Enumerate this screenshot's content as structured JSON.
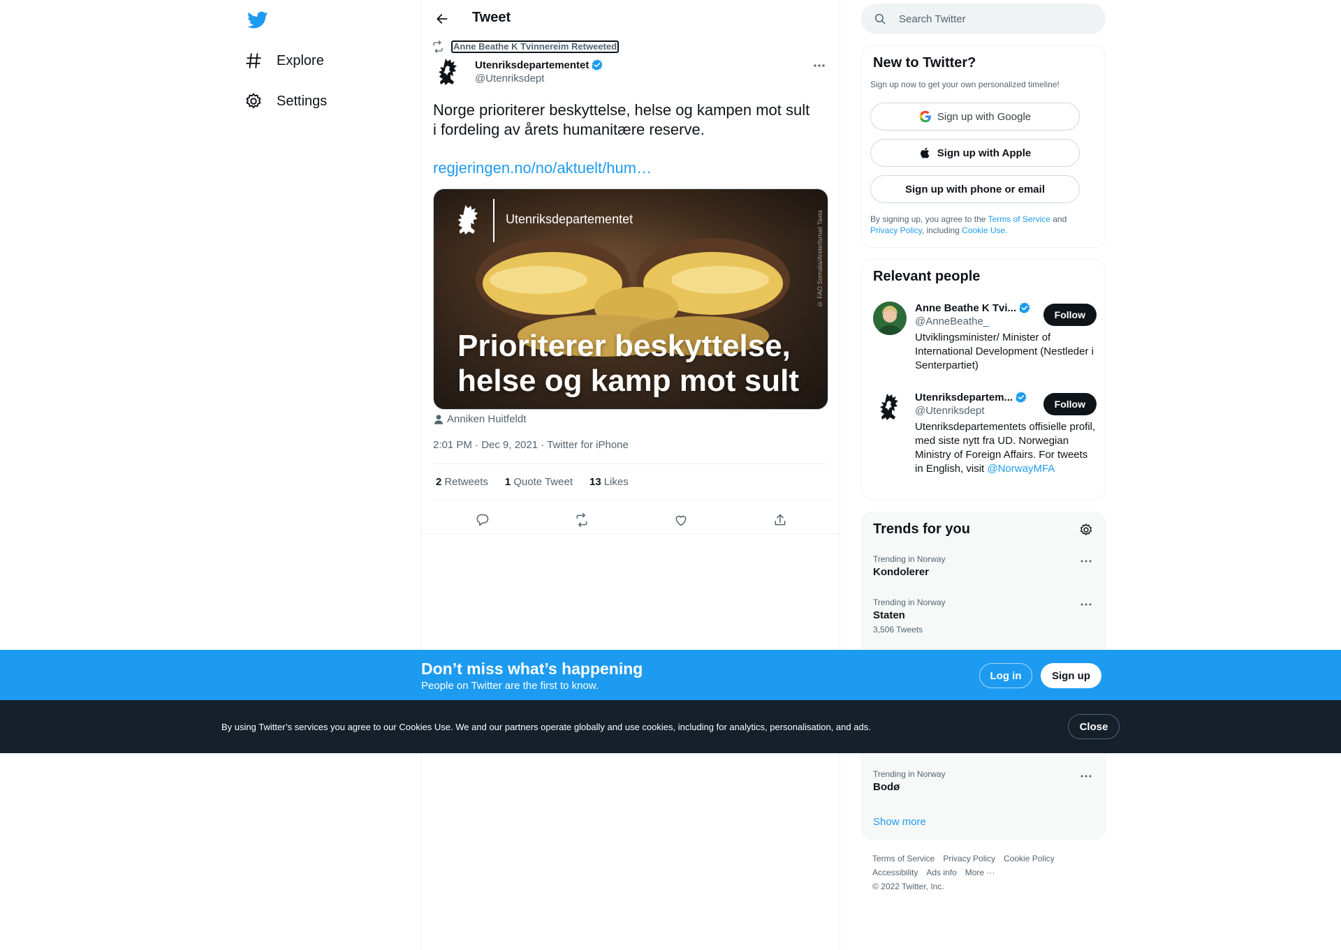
{
  "nav": {
    "items": [
      {
        "label": "Explore",
        "icon": "hashtag-icon"
      },
      {
        "label": "Settings",
        "icon": "gear-icon"
      }
    ]
  },
  "header": {
    "title": "Tweet"
  },
  "tweet": {
    "retweeted_by": "Anne Beathe K Tvinnereim Retweeted",
    "author_name": "Utenriksdepartementet",
    "author_handle": "@Utenriksdept",
    "text": "Norge prioriterer beskyttelse, helse og kampen mot sult\ni fordeling av årets humanitære reserve.",
    "link": "regjeringen.no/no/aktuelt/hum…",
    "media": {
      "brand": "Utenriksdepartementet",
      "headline": "Prioriterer beskyttelse,\nhelse og kamp mot sult",
      "credit": "© FAO Somalia/Arete/Ismail Taxta"
    },
    "tagged_person": "Anniken Huitfeldt",
    "timestamp": "2:01 PM · Dec 9, 2021 · Twitter for iPhone",
    "stats": {
      "retweets_count": "2",
      "retweets_label": "Retweets",
      "quotes_count": "1",
      "quotes_label": "Quote Tweet",
      "likes_count": "13",
      "likes_label": "Likes"
    }
  },
  "search": {
    "placeholder": "Search Twitter"
  },
  "new_to_twitter": {
    "title": "New to Twitter?",
    "subtitle": "Sign up now to get your own personalized timeline!",
    "google_label": "Sign up with Google",
    "apple_label": "Sign up with Apple",
    "phone_label": "Sign up with phone or email",
    "terms_prefix": "By signing up, you agree to the ",
    "terms_link": "Terms of Service",
    "terms_and": " and ",
    "privacy_link": "Privacy Policy",
    "terms_including": ", including ",
    "cookie_link": "Cookie Use."
  },
  "relevant_people": {
    "title": "Relevant people",
    "people": [
      {
        "name": "Anne Beathe K Tvi...",
        "handle": "@AnneBeathe_",
        "bio": "Utviklingsminister/ Minister of International Development (Nestleder i Senterpartiet)",
        "follow_label": "Follow"
      },
      {
        "name": "Utenriksdepartem...",
        "handle": "@Utenriksdept",
        "bio": "Utenriksdepartementets offisielle profil, med siste nytt fra UD. Norwegian Ministry of Foreign Affairs. For tweets in English, visit ",
        "bio_link": "@NorwayMFA",
        "follow_label": "Follow"
      }
    ]
  },
  "trends": {
    "title": "Trends for you",
    "items": [
      {
        "context": "Trending in Norway",
        "name": "Kondolerer",
        "count": ""
      },
      {
        "context": "Trending in Norway",
        "name": "Staten",
        "count": "3,506 Tweets"
      },
      {
        "context": "Trending in Norway",
        "name": "Bodø",
        "count": ""
      }
    ],
    "show_more": "Show more"
  },
  "footer": {
    "links": [
      "Terms of Service",
      "Privacy Policy",
      "Cookie Policy",
      "Accessibility",
      "Ads info",
      "More ···"
    ],
    "copyright": "© 2022 Twitter, Inc."
  },
  "promo": {
    "title": "Don’t miss what’s happening",
    "subtitle": "People on Twitter are the first to know.",
    "login_label": "Log in",
    "signup_label": "Sign up"
  },
  "cookie_bar": {
    "text": "By using Twitter’s services you agree to our Cookies Use. We and our partners operate globally and use cookies, including for analytics, personalisation, and ads.",
    "close_label": "Close"
  },
  "colors": {
    "accent": "#1d9bf0",
    "text": "#0f1419",
    "secondary": "#536471",
    "cookie_bg": "#15202b"
  }
}
